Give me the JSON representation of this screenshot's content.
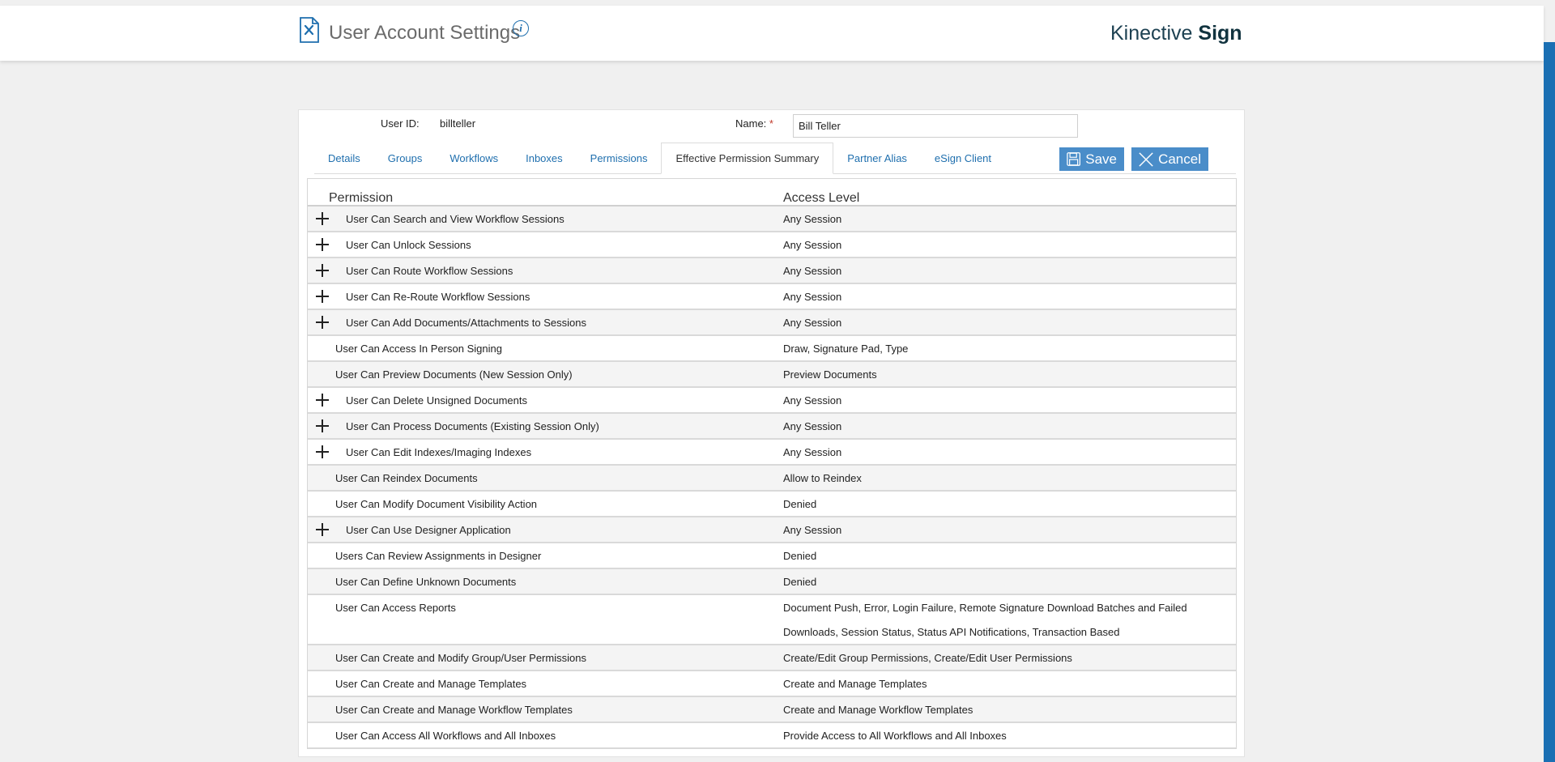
{
  "header": {
    "title": "User Account Settings",
    "brand_light": "Kinective",
    "brand_bold": "Sign",
    "info_icon_glyph": "i"
  },
  "form": {
    "user_id_label": "User ID:",
    "user_id_value": "billteller",
    "name_label": "Name:",
    "name_required": "*",
    "name_value": "Bill Teller"
  },
  "tabs": [
    {
      "label": "Details"
    },
    {
      "label": "Groups"
    },
    {
      "label": "Workflows"
    },
    {
      "label": "Inboxes"
    },
    {
      "label": "Permissions"
    },
    {
      "label": "Effective Permission Summary",
      "active": true
    },
    {
      "label": "Partner Alias"
    },
    {
      "label": "eSign Client"
    }
  ],
  "actions": {
    "save_label": "Save",
    "cancel_label": "Cancel"
  },
  "table": {
    "col_permission": "Permission",
    "col_access": "Access Level",
    "rows": [
      {
        "permission": "User Can Search and View Workflow Sessions",
        "access": "Any Session",
        "expandable": true
      },
      {
        "permission": "User Can Unlock Sessions",
        "access": "Any Session",
        "expandable": true
      },
      {
        "permission": "User Can Route Workflow Sessions",
        "access": "Any Session",
        "expandable": true
      },
      {
        "permission": "User Can Re-Route Workflow Sessions",
        "access": "Any Session",
        "expandable": true
      },
      {
        "permission": "User Can Add Documents/Attachments to Sessions",
        "access": "Any Session",
        "expandable": true
      },
      {
        "permission": "User Can Access In Person Signing",
        "access": "Draw, Signature Pad, Type",
        "expandable": false
      },
      {
        "permission": "User Can Preview Documents (New Session Only)",
        "access": "Preview Documents",
        "expandable": false
      },
      {
        "permission": "User Can Delete Unsigned Documents",
        "access": "Any Session",
        "expandable": true
      },
      {
        "permission": "User Can Process Documents (Existing Session Only)",
        "access": "Any Session",
        "expandable": true
      },
      {
        "permission": "User Can Edit Indexes/Imaging Indexes",
        "access": "Any Session",
        "expandable": true
      },
      {
        "permission": "User Can Reindex Documents",
        "access": "Allow to Reindex",
        "expandable": false
      },
      {
        "permission": "User Can Modify Document Visibility Action",
        "access": "Denied",
        "expandable": false
      },
      {
        "permission": "User Can Use Designer Application",
        "access": "Any Session",
        "expandable": true
      },
      {
        "permission": "Users Can Review Assignments in Designer",
        "access": "Denied",
        "expandable": false
      },
      {
        "permission": "User Can Define Unknown Documents",
        "access": "Denied",
        "expandable": false
      },
      {
        "permission": "User Can Access Reports",
        "access": "Document Push, Error, Login Failure, Remote Signature Download Batches and Failed Downloads, Session Status, Status API Notifications, Transaction Based",
        "expandable": false,
        "tall": true
      },
      {
        "permission": "User Can Create and Modify Group/User Permissions",
        "access": "Create/Edit Group Permissions, Create/Edit User Permissions",
        "expandable": false
      },
      {
        "permission": "User Can Create and Manage Templates",
        "access": "Create and Manage Templates",
        "expandable": false
      },
      {
        "permission": "User Can Create and Manage Workflow Templates",
        "access": "Create and Manage Workflow Templates",
        "expandable": false
      },
      {
        "permission": "User Can Access All Workflows and All Inboxes",
        "access": "Provide Access to All Workflows and All Inboxes",
        "expandable": false
      }
    ]
  },
  "colors": {
    "accent": "#1f6fae",
    "button": "#4a8dc9",
    "sidebar": "#1a6fb3",
    "brand": "#1d4152"
  },
  "icons": [
    "document-settings-icon",
    "info-icon",
    "save-icon",
    "close-icon",
    "plus-icon"
  ]
}
